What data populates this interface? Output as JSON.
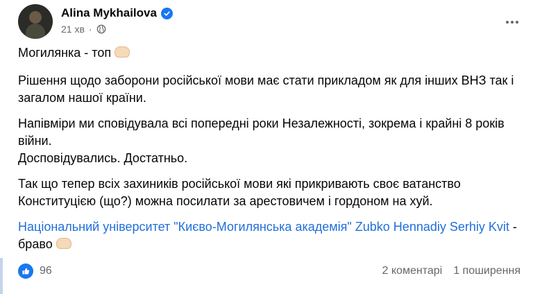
{
  "post": {
    "author": "Alina Mykhailova",
    "time": "21 хв",
    "dot": "·",
    "paragraph1_text": "Могилянка - топ",
    "paragraph2": "Рішення щодо заборони російської мови має стати прикладом як для інших ВНЗ так і загалом нашої країни.",
    "paragraph3_line1": "Напівміри ми сповідувала всі попередні роки Незалежності, зокрема і крайні 8 років війни.",
    "paragraph3_line2": "Досповідувались. Достатньо.",
    "paragraph4": "Так що тепер всіх захиників російської мови які прикривають своє ватанство Конституцією (що?) можна посилати за арестовичем і гордоном на хуй.",
    "mention_university": "Національний університет \"Києво-Могилянська академія\"",
    "mention_person": "Zubko Hennadiy Serhiy Kvit",
    "paragraph5_suffix": " - браво"
  },
  "stats": {
    "reactions": "96",
    "comments": "2 коментарі",
    "shares": "1 поширення"
  },
  "colors": {
    "link": "#216fdb",
    "verified": "#1877f2",
    "secondary_text": "#65676b"
  },
  "icons": [
    "verified-badge-icon",
    "globe-icon",
    "more-options-icon",
    "like-reaction-icon",
    "handshake-emoji-icon",
    "heart-hands-emoji-icon"
  ]
}
